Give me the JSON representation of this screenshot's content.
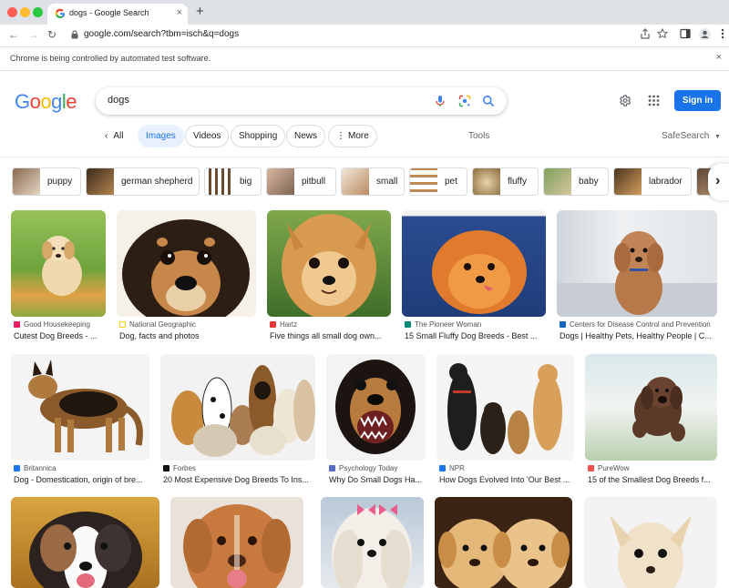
{
  "browser": {
    "tab_title": "dogs - Google Search",
    "tab_close": "×",
    "new_tab": "+",
    "url": "google.com/search?tbm=isch&q=dogs",
    "infobar_text": "Chrome is being controlled by automated test software.",
    "infobar_close": "×",
    "nav": {
      "back": "←",
      "forward": "→",
      "reload": "↻"
    }
  },
  "search": {
    "query": "dogs",
    "signin_label": "Sign in"
  },
  "tabs": {
    "all": "All",
    "images": "Images",
    "videos": "Videos",
    "shopping": "Shopping",
    "news": "News",
    "more": "More",
    "tools": "Tools",
    "safesearch": "SafeSearch"
  },
  "chips": [
    {
      "label": "puppy"
    },
    {
      "label": "german shepherd"
    },
    {
      "label": "big"
    },
    {
      "label": "pitbull"
    },
    {
      "label": "small"
    },
    {
      "label": "pet"
    },
    {
      "label": "fluffy"
    },
    {
      "label": "baby"
    },
    {
      "label": "labrador"
    }
  ],
  "results": [
    {
      "source": "Good Housekeeping",
      "caption": "Cutest Dog Breeds - ..."
    },
    {
      "source": "National Geographic",
      "caption": "Dog, facts and photos"
    },
    {
      "source": "Hartz",
      "caption": "Five things all small dog own..."
    },
    {
      "source": "The Pioneer Woman",
      "caption": "15 Small Fluffy Dog Breeds - Best ..."
    },
    {
      "source": "Centers for Disease Control and Prevention",
      "caption": "Dogs | Healthy Pets, Healthy People | C..."
    },
    {
      "source": "Britannica",
      "caption": "Dog - Domestication, origin of bre..."
    },
    {
      "source": "Forbes",
      "caption": "20 Most Expensive Dog Breeds To Ins..."
    },
    {
      "source": "Psychology Today",
      "caption": "Why Do Small Dogs Ha..."
    },
    {
      "source": "NPR",
      "caption": "How Dogs Evolved Into 'Our Best ..."
    },
    {
      "source": "PureWow",
      "caption": "15 of the Smallest Dog Breeds f..."
    }
  ],
  "colors": {
    "accent": "#1a73e8",
    "google_blue": "#4285f4",
    "google_red": "#ea4335",
    "google_yellow": "#fbbc05",
    "google_green": "#34a853"
  },
  "icons": [
    "google-favicon-icon",
    "lock-icon",
    "share-icon",
    "star-icon",
    "sidepanel-icon",
    "profile-icon",
    "kebab-menu-icon",
    "mic-icon",
    "lens-icon",
    "search-icon",
    "gear-icon",
    "apps-grid-icon",
    "chevron-left-icon",
    "chevron-right-icon",
    "chevron-down-icon",
    "more-dots-icon"
  ]
}
